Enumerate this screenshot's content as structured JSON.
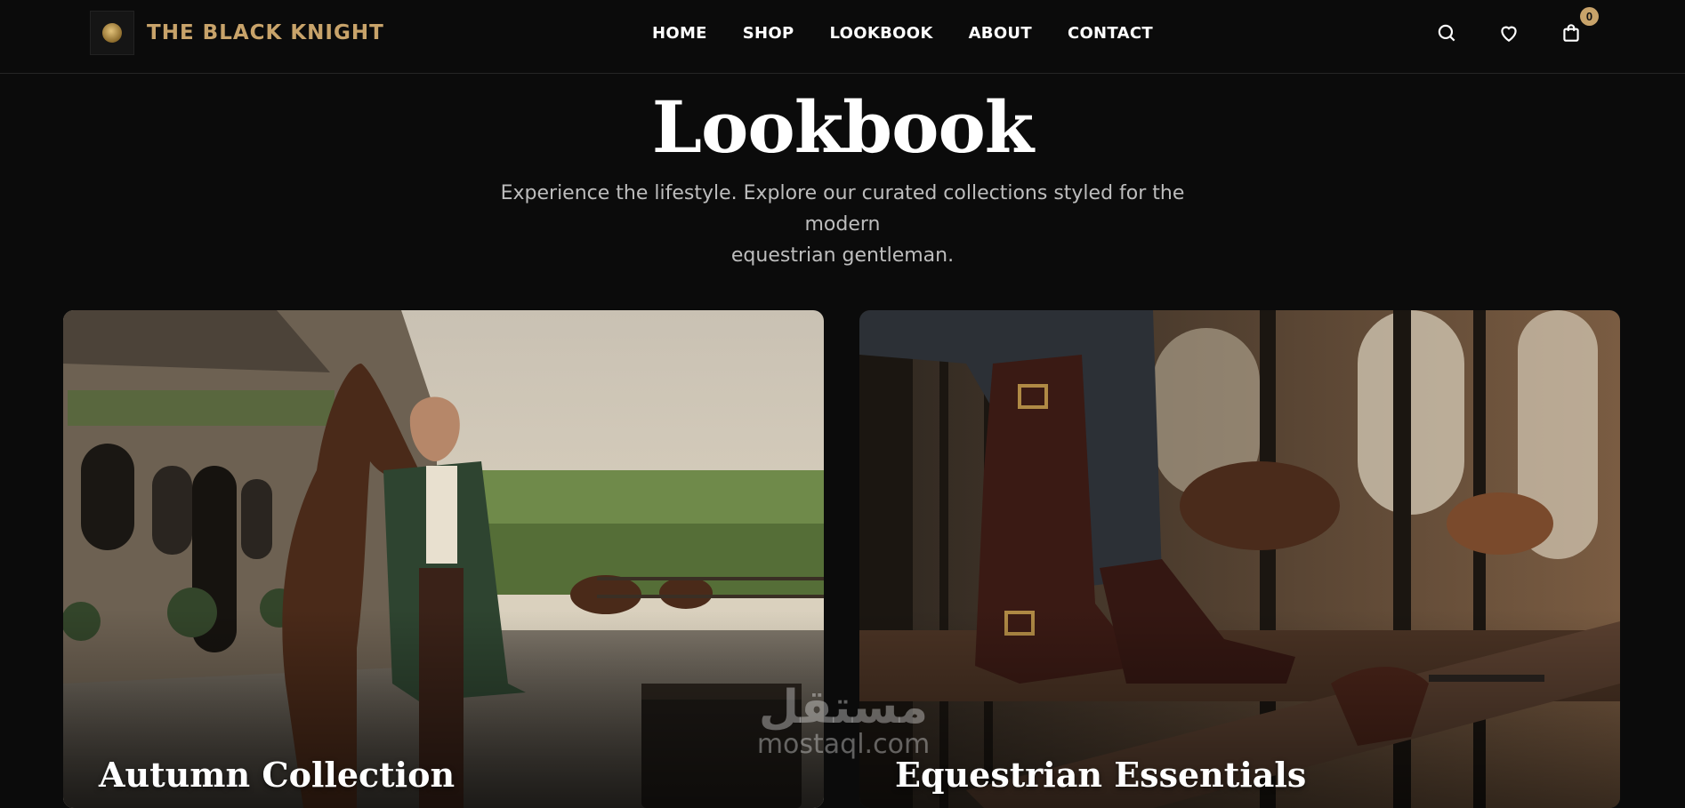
{
  "header": {
    "brand": "THE BLACK KNIGHT",
    "logo_icon": "knight-emblem-icon",
    "nav": [
      "HOME",
      "SHOP",
      "LOOKBOOK",
      "ABOUT",
      "CONTACT"
    ],
    "icons": [
      "search-icon",
      "heart-icon",
      "shopping-bag-icon"
    ],
    "cart_count": "0",
    "accent_color": "#c8a36a"
  },
  "hero": {
    "title": "Lookbook",
    "subtitle_line1": "Experience the lifestyle. Explore our curated collections styled for the modern",
    "subtitle_line2": "equestrian gentleman."
  },
  "collections": [
    {
      "title": "Autumn Collection"
    },
    {
      "title": "Equestrian Essentials"
    }
  ],
  "watermark": {
    "arabic": "مستقل",
    "latin": "mostaql.com"
  }
}
